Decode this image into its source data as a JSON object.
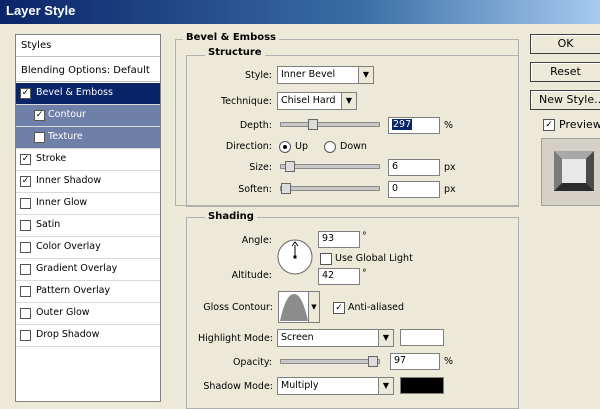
{
  "window": {
    "title": "Layer Style"
  },
  "styles_list": {
    "header": "Styles",
    "blending": "Blending Options: Default",
    "items": [
      {
        "label": "Bevel & Emboss",
        "checked": true,
        "selected": "dark"
      },
      {
        "label": "Contour",
        "checked": true,
        "selected": "light",
        "indent": true
      },
      {
        "label": "Texture",
        "checked": false,
        "selected": "light",
        "indent": true
      },
      {
        "label": "Stroke",
        "checked": true
      },
      {
        "label": "Inner Shadow",
        "checked": true
      },
      {
        "label": "Inner Glow",
        "checked": false
      },
      {
        "label": "Satin",
        "checked": false
      },
      {
        "label": "Color Overlay",
        "checked": false
      },
      {
        "label": "Gradient Overlay",
        "checked": false
      },
      {
        "label": "Pattern Overlay",
        "checked": false
      },
      {
        "label": "Outer Glow",
        "checked": false
      },
      {
        "label": "Drop Shadow",
        "checked": false
      }
    ]
  },
  "bevel": {
    "section_title": "Bevel & Emboss",
    "structure": {
      "title": "Structure",
      "style_label": "Style:",
      "style_value": "Inner Bevel",
      "technique_label": "Technique:",
      "technique_value": "Chisel Hard",
      "depth_label": "Depth:",
      "depth_value": "297",
      "depth_unit": "%",
      "depth_level": 0.3,
      "direction_label": "Direction:",
      "direction_up": "Up",
      "direction_down": "Down",
      "size_label": "Size:",
      "size_value": "6",
      "size_unit": "px",
      "size_level": 0.04,
      "soften_label": "Soften:",
      "soften_value": "0",
      "soften_unit": "px",
      "soften_level": 0.0
    },
    "shading": {
      "title": "Shading",
      "angle_label": "Angle:",
      "angle_value": "93",
      "angle_unit": "°",
      "use_global_light": "Use Global Light",
      "altitude_label": "Altitude:",
      "altitude_value": "42",
      "altitude_unit": "°",
      "gloss_contour_label": "Gloss Contour:",
      "anti_aliased": "Anti-aliased",
      "highlight_mode_label": "Highlight Mode:",
      "highlight_mode_value": "Screen",
      "opacity_label": "Opacity:",
      "opacity_value": "97",
      "opacity_unit": "%",
      "opacity_level": 0.97,
      "shadow_mode_label": "Shadow Mode:",
      "shadow_mode_value": "Multiply"
    }
  },
  "buttons": {
    "ok": "OK",
    "reset": "Reset",
    "new_style": "New Style...",
    "preview": "Preview"
  },
  "colors": {
    "highlight_swatch": "#ffffff",
    "shadow_swatch": "#000000"
  }
}
